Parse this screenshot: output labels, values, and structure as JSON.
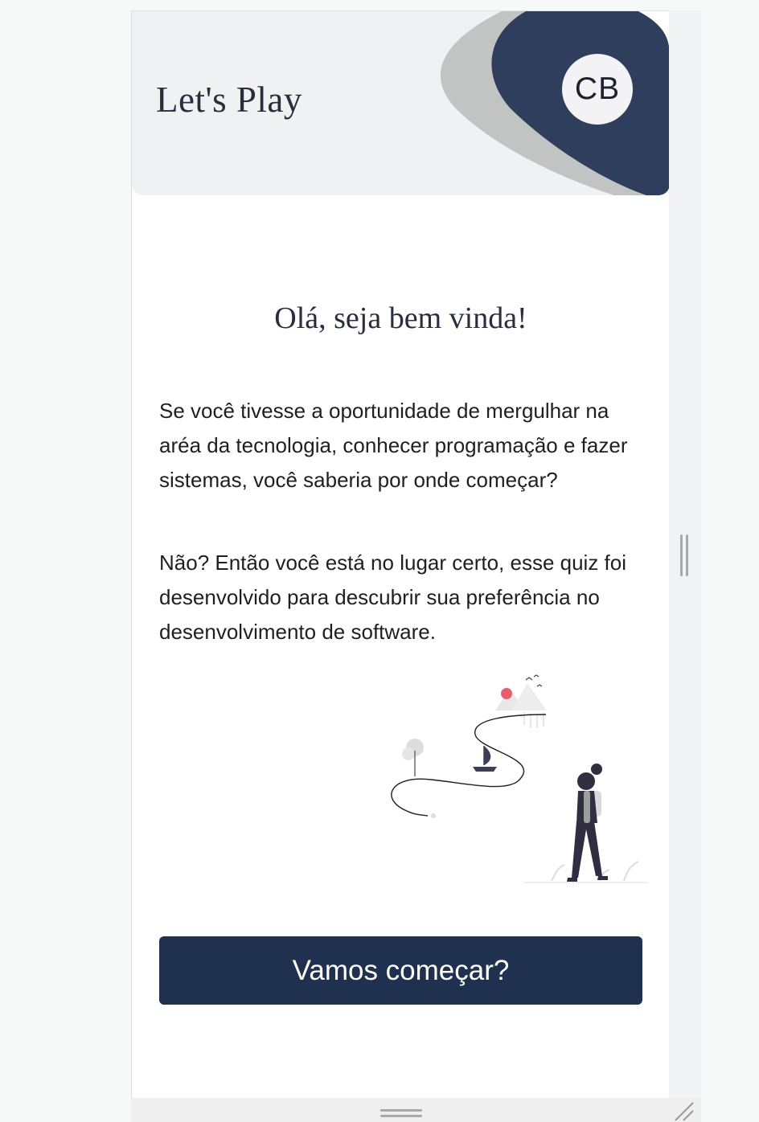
{
  "header": {
    "title": "Let's Play",
    "avatar_initials": "CB"
  },
  "main": {
    "welcome": "Olá, seja bem vinda!",
    "paragraphs": [
      "Se você tivesse a oportunidade de mergulhar na aréa da tecnologia, conhecer programação e fazer sistemas, você saberia por onde começar?",
      "Não? Então você está no lugar certo, esse quiz foi desenvolvido para descubrir sua preferência no desenvolvimento de software."
    ],
    "illustration_icon": "woman-walking-path-illustration",
    "start_button": "Vamos começar?"
  },
  "colors": {
    "primary": "#20304f",
    "header_bg": "#f0f1f3",
    "wave_gray": "#c2c4c4",
    "wave_navy": "#2f3e5c",
    "accent_red": "#e85d6e"
  }
}
